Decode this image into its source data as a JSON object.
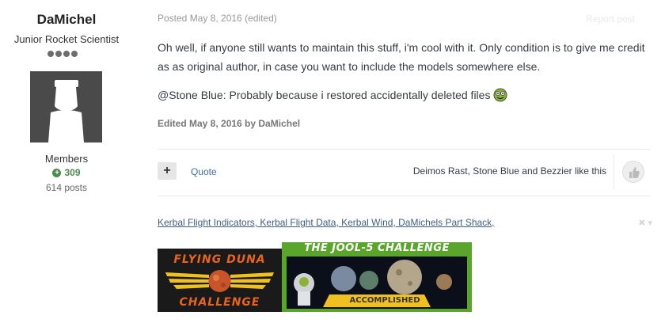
{
  "author": {
    "name": "DaMichel",
    "title": "Junior Rocket Scientist",
    "group": "Members",
    "reputation": "309",
    "posts": "614 posts"
  },
  "post": {
    "meta": "Posted May 8, 2016 (edited)",
    "report": "Report post",
    "paragraph1": "Oh well, if anyone still wants to maintain this stuff, i'm cool with it. Only condition is to give me credit as as original author, in case you want to include the models somewhere else.",
    "paragraph2": "@Stone Blue: Probably because i restored accidentally deleted files",
    "edited": "Edited May 8, 2016 by DaMichel"
  },
  "actions": {
    "plus": "+",
    "quote": "Quote",
    "likes": "Deimos Rast, Stone Blue and Bezzier like this"
  },
  "signature": {
    "links": "Kerbal Flight Indicators, Kerbal Flight Data, Kerbal Wind, DaMichels Part Shack,",
    "close": "✖ ▾",
    "banner1_top": "FLYING DUNA",
    "banner1_bottom": "CHALLENGE",
    "banner2_title": "THE JOOL-5 CHALLENGE",
    "banner2_badge": "ACCOMPLISHED"
  },
  "colors": {
    "link": "#3f6ea5",
    "reputation": "#4e8a4a",
    "avatar_bg": "#555555"
  }
}
